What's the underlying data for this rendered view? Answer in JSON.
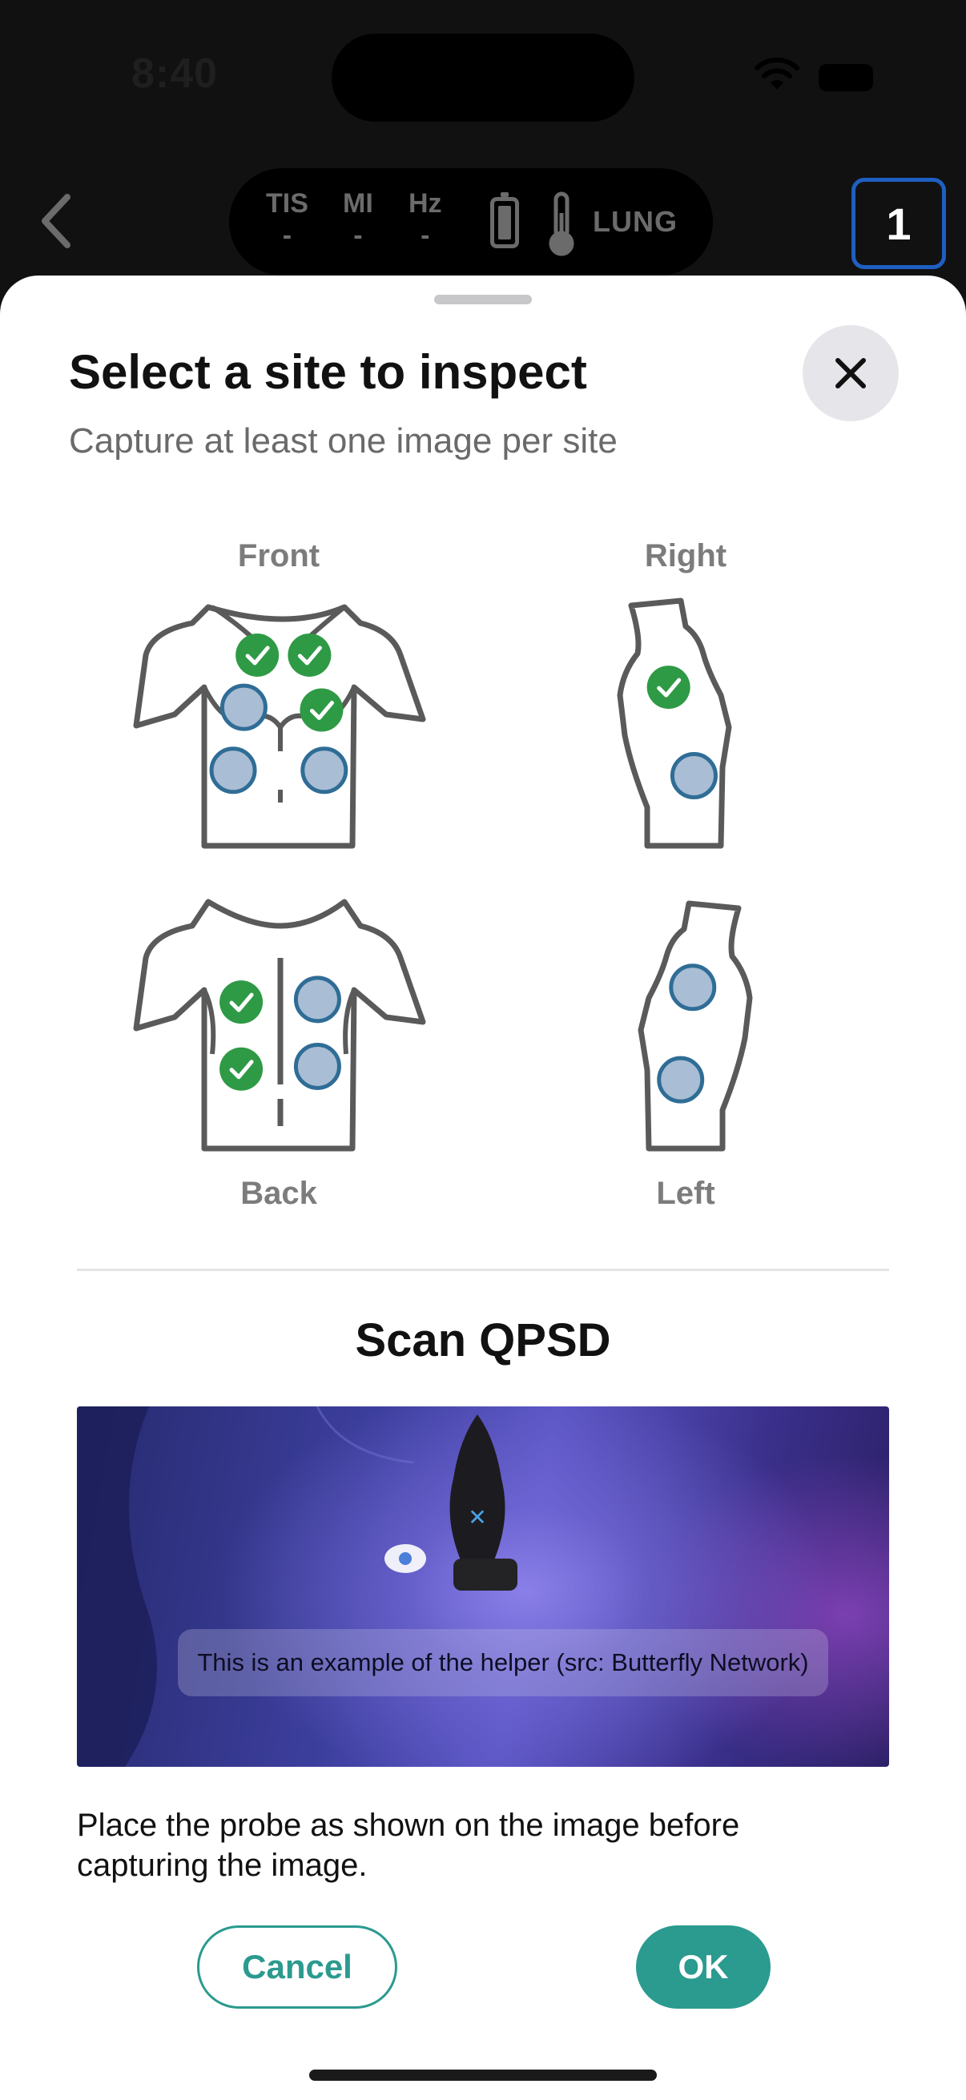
{
  "status_bar": {
    "time": "8:40"
  },
  "toolbar": {
    "metrics": [
      {
        "label": "TIS",
        "value": "-"
      },
      {
        "label": "MI",
        "value": "-"
      },
      {
        "label": "Hz",
        "value": "-"
      }
    ],
    "preset": "LUNG",
    "image_count": "1"
  },
  "sheet": {
    "title": "Select a site to inspect",
    "subtitle": "Capture at least one image per site",
    "views": {
      "front": "Front",
      "right": "Right",
      "back": "Back",
      "left": "Left"
    },
    "scan_title": "Scan QPSD",
    "helper_caption": "This is an example of the helper (src: Butterfly Network)",
    "instruction": "Place the probe as shown on the image before capturing the image.",
    "cancel_label": "Cancel",
    "ok_label": "OK"
  },
  "colors": {
    "accent": "#2b9a8f",
    "site_done": "#2e9a45",
    "site_pending": "#a9bdd4",
    "site_pending_border": "#2f6d96"
  },
  "sites": {
    "front": [
      "done",
      "done",
      "pending",
      "done",
      "pending",
      "pending"
    ],
    "right": [
      "done",
      "pending"
    ],
    "back": [
      "done",
      "pending",
      "done",
      "pending"
    ],
    "left": [
      "pending",
      "pending"
    ]
  }
}
